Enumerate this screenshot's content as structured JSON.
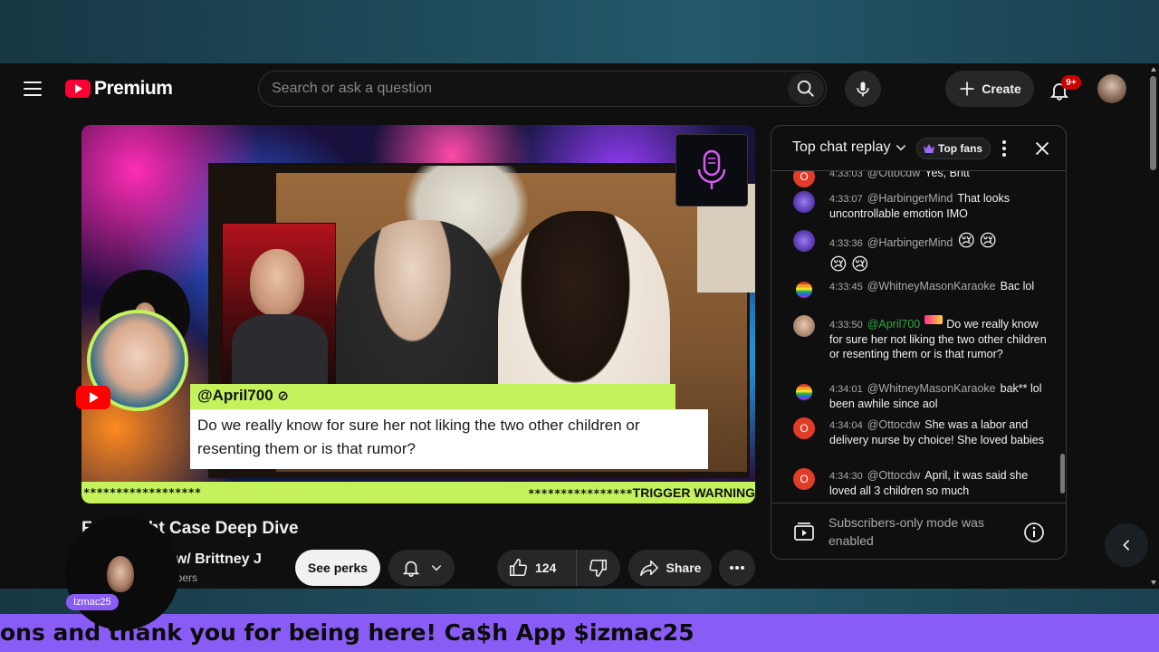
{
  "app": {
    "brand": "Premium",
    "search_placeholder": "Search or ask a question",
    "create_label": "Create",
    "notification_count": "9+"
  },
  "player": {
    "overlay_chat": {
      "username": "@April700",
      "message": "Do we really know for sure her not liking the two other children or resenting them or is that rumor?"
    },
    "tape_left": "******************",
    "tape_right_stars": "****************",
    "tape_right_text": "TRIGGER WARNING"
  },
  "video": {
    "title_visible": "F",
    "title_tail": "light Case Deep Dive",
    "channel_visible": "ly w/ Brittney J",
    "subscribers_visible": "scribers",
    "see_perks_label": "See perks",
    "like_count": "124",
    "share_label": "Share"
  },
  "chat": {
    "mode_label": "Top chat replay",
    "top_fans_label": "Top fans",
    "messages": [
      {
        "time": "4:33:03",
        "author": "@Ottocdw",
        "text": "Yes, Britt",
        "avatar": "O"
      },
      {
        "time": "4:33:07",
        "author": "@HarbingerMind",
        "text": "That looks uncontrollable emotion IMO"
      },
      {
        "time": "4:33:36",
        "author": "@HarbingerMind",
        "emojis": [
          "😢",
          "😢",
          "😢",
          "😢"
        ]
      },
      {
        "time": "4:33:45",
        "author": "@WhitneyMasonKaraoke",
        "text": "Bac lol"
      },
      {
        "time": "4:33:50",
        "author": "@April700",
        "text": "Do we really know for sure her not liking the two other children or resenting them or is that rumor?"
      },
      {
        "time": "4:34:01",
        "author": "@WhitneyMasonKaraoke",
        "text": "bak** lol been awhile since aol"
      },
      {
        "time": "4:34:04",
        "author": "@Ottocdw",
        "text": "She was a labor and delivery nurse by choice! She loved babies",
        "avatar": "O"
      },
      {
        "time": "4:34:30",
        "author": "@Ottocdw",
        "text": "April, it was said she loved all 3 children so much",
        "avatar": "O"
      }
    ],
    "footer_text": "Subscribers-only mode was enabled"
  },
  "stream_overlay": {
    "cam_tag": "Izmac25",
    "ticker": "ons and thank you for being here! Ca$h App $izmac25"
  },
  "colors": {
    "accent_green": "#c3f25c",
    "ticker_purple": "#8a5cf6",
    "youtube_red": "#ff0033"
  }
}
